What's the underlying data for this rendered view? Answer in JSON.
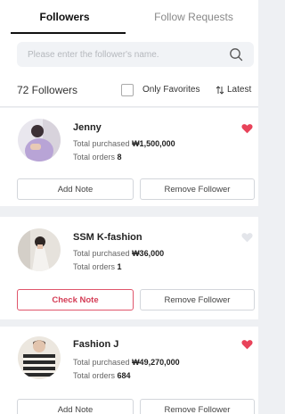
{
  "tabs": [
    {
      "label": "Followers",
      "active": true
    },
    {
      "label": "Follow Requests",
      "active": false
    }
  ],
  "search": {
    "placeholder": "Please enter the follower's name."
  },
  "filter": {
    "count_text": "72 Followers",
    "favorites_label": "Only Favorites",
    "favorites_checked": false,
    "sort_label": "Latest"
  },
  "labels": {
    "total_purchased": "Total purchased",
    "total_orders": "Total orders"
  },
  "followers": [
    {
      "name": "Jenny",
      "total_purchased": "₩1,500,000",
      "total_orders": "8",
      "favorite": true,
      "note_button": "Add Note",
      "remove_button": "Remove Follower"
    },
    {
      "name": "SSM K-fashion",
      "total_purchased": "₩36,000",
      "total_orders": "1",
      "favorite": false,
      "note_button": "Check Note",
      "remove_button": "Remove Follower"
    },
    {
      "name": "Fashion J",
      "total_purchased": "₩49,270,000",
      "total_orders": "684",
      "favorite": true,
      "note_button": "Add Note",
      "remove_button": "Remove Follower"
    }
  ],
  "colors": {
    "heart_active": "#e8435a",
    "heart_inactive": "#e3e5ea",
    "accent": "#d43c55"
  }
}
